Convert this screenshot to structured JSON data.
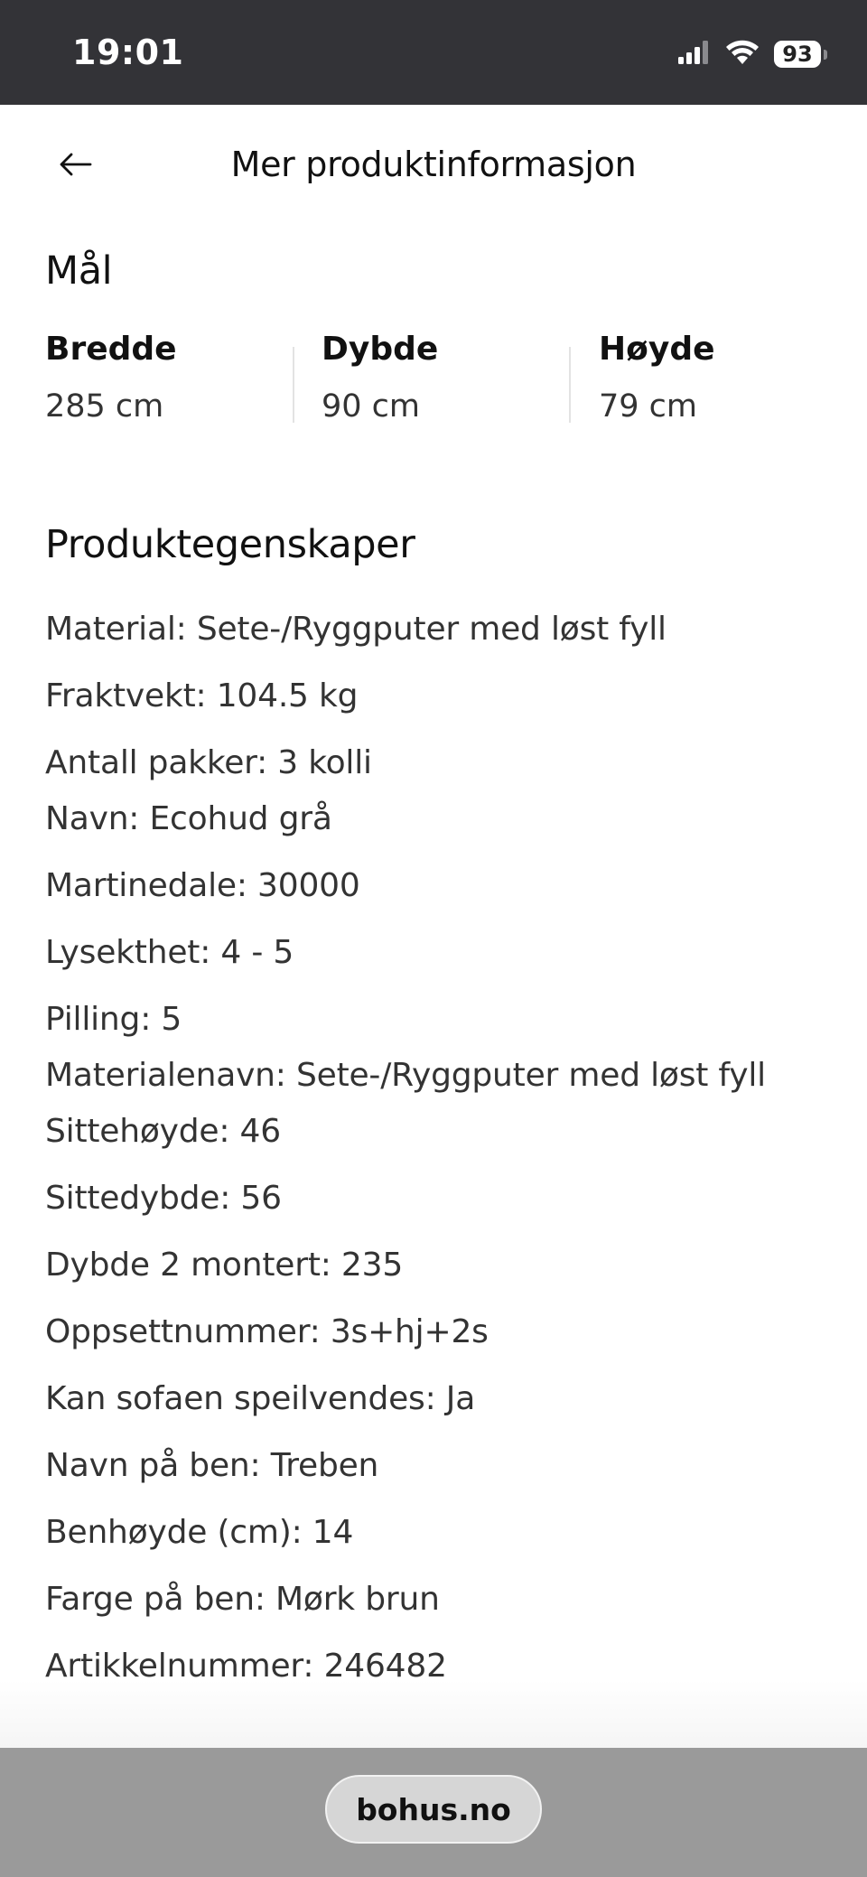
{
  "status_bar": {
    "time": "19:01",
    "battery": "93",
    "icons": [
      "cellular-signal-icon",
      "wifi-icon",
      "battery-icon"
    ]
  },
  "header": {
    "title": "Mer produktinformasjon",
    "back_icon": "arrow-left-icon"
  },
  "dimensions": {
    "heading": "Mål",
    "items": [
      {
        "label": "Bredde",
        "value": "285 cm"
      },
      {
        "label": "Dybde",
        "value": "90 cm"
      },
      {
        "label": "Høyde",
        "value": "79 cm"
      }
    ]
  },
  "properties": {
    "heading": "Produktegenskaper",
    "items": [
      "Material: Sete-/Ryggputer med løst fyll",
      "Fraktvekt: 104.5 kg",
      "Antall pakker: 3 kolli",
      "Navn: Ecohud grå",
      "Martinedale: 30000",
      "Lysekthet: 4 - 5",
      "Pilling: 5",
      "Materialenavn: Sete-/Ryggputer med løst fyll",
      "Sittehøyde: 46",
      "Sittedybde: 56",
      "Dybde 2 montert: 235",
      "Oppsettnummer: 3s+hj+2s",
      "Kan sofaen speilvendes: Ja",
      "Navn på ben: Treben",
      "Benhøyde (cm): 14",
      "Farge på ben: Mørk brun",
      "Artikkelnummer: 246482"
    ]
  },
  "browser": {
    "url": "bohus.no"
  },
  "colors": {
    "status_bar_bg": "#333337",
    "browser_bar_bg": "#9a9a9a",
    "text_primary": "#111111",
    "text_secondary": "#333333"
  }
}
